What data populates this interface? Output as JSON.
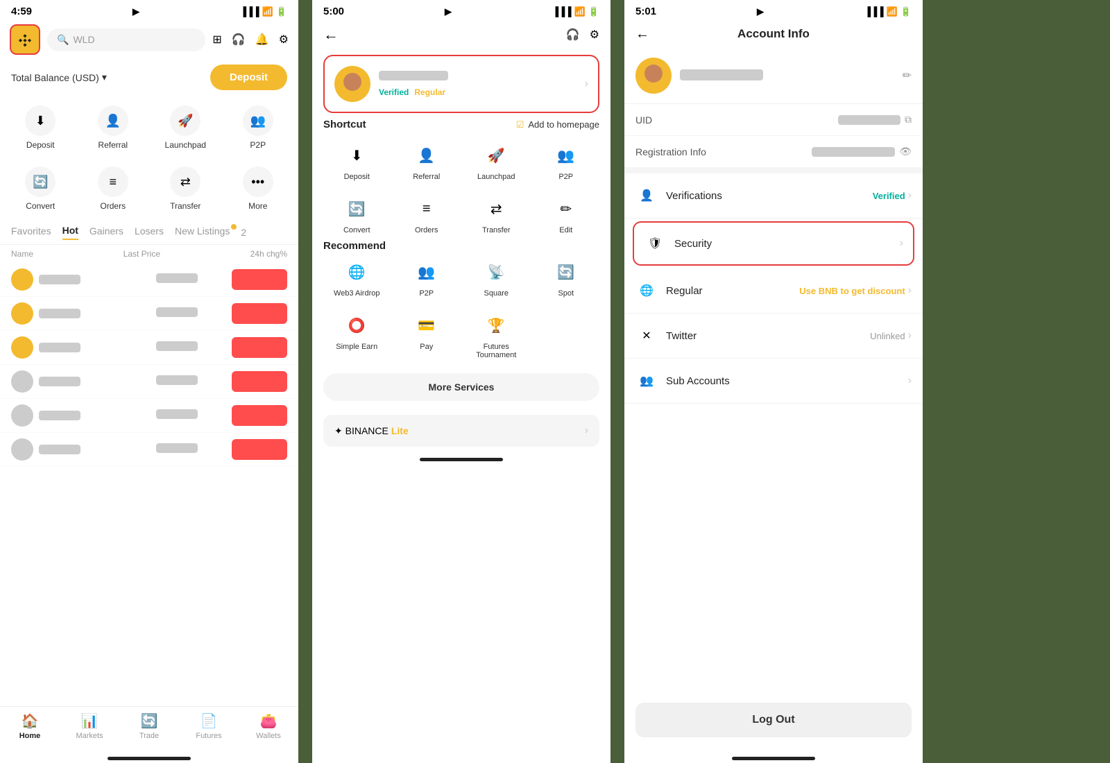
{
  "phone1": {
    "status": {
      "time": "4:59",
      "nav_icon": "▶"
    },
    "header": {
      "search_placeholder": "WLD"
    },
    "balance": {
      "label": "Total Balance (USD)",
      "deposit_btn": "Deposit"
    },
    "quick_actions": [
      {
        "icon": "⬇",
        "label": "Deposit"
      },
      {
        "icon": "👤",
        "label": "Referral"
      },
      {
        "icon": "🚀",
        "label": "Launchpad"
      },
      {
        "icon": "👥",
        "label": "P2P"
      },
      {
        "icon": "🔄",
        "label": "Convert"
      },
      {
        "icon": "≡",
        "label": "Orders"
      },
      {
        "icon": "⇄",
        "label": "Transfer"
      },
      {
        "icon": "•••",
        "label": "More"
      }
    ],
    "tabs": [
      {
        "label": "Favorites",
        "active": false
      },
      {
        "label": "Hot",
        "active": true
      },
      {
        "label": "Gainers",
        "active": false
      },
      {
        "label": "Losers",
        "active": false
      },
      {
        "label": "New Listings",
        "active": false,
        "badge": true
      }
    ],
    "market_headers": [
      "Name",
      "Last Price",
      "24h chg%"
    ],
    "market_rows": [
      {
        "coin_color": "yellow"
      },
      {
        "coin_color": "yellow"
      },
      {
        "coin_color": "yellow"
      },
      {
        "coin_color": "gray"
      },
      {
        "coin_color": "gray"
      },
      {
        "coin_color": "gray"
      }
    ],
    "bottom_nav": [
      {
        "icon": "🏠",
        "label": "Home",
        "active": true
      },
      {
        "icon": "📊",
        "label": "Markets",
        "active": false
      },
      {
        "icon": "🔄",
        "label": "Trade",
        "active": false
      },
      {
        "icon": "📄",
        "label": "Futures",
        "active": false
      },
      {
        "icon": "👛",
        "label": "Wallets",
        "active": false
      }
    ]
  },
  "phone2": {
    "status": {
      "time": "5:00",
      "nav_icon": "▶"
    },
    "profile": {
      "verified_badge": "Verified",
      "regular_badge": "Regular"
    },
    "shortcut": {
      "title": "Shortcut",
      "add_to_homepage": "Add to homepage"
    },
    "shortcut_items": [
      {
        "icon": "⬇",
        "label": "Deposit"
      },
      {
        "icon": "👤",
        "label": "Referral"
      },
      {
        "icon": "🚀",
        "label": "Launchpad"
      },
      {
        "icon": "👥",
        "label": "P2P"
      },
      {
        "icon": "🔄",
        "label": "Convert"
      },
      {
        "icon": "≡",
        "label": "Orders"
      },
      {
        "icon": "⇄",
        "label": "Transfer"
      },
      {
        "icon": "✏",
        "label": "Edit"
      }
    ],
    "recommend": {
      "title": "Recommend"
    },
    "recommend_items": [
      {
        "icon": "🌐",
        "label": "Web3 Airdrop"
      },
      {
        "icon": "👥",
        "label": "P2P"
      },
      {
        "icon": "📡",
        "label": "Square"
      },
      {
        "icon": "🔄",
        "label": "Spot"
      },
      {
        "icon": "⭕",
        "label": "Simple Earn"
      },
      {
        "icon": "💳",
        "label": "Pay"
      },
      {
        "icon": "🏆",
        "label": "Futures Tournament"
      }
    ],
    "more_services_btn": "More Services",
    "binance_lite": {
      "prefix": "✦ BINANCE",
      "suffix": "Lite"
    }
  },
  "phone3": {
    "status": {
      "time": "5:01",
      "nav_icon": "▶"
    },
    "page_title": "Account Info",
    "uid_label": "UID",
    "registration_label": "Registration Info",
    "menu_items": [
      {
        "icon": "👤",
        "label": "Verifications",
        "value": "Verified",
        "value_color": "green",
        "chevron": true,
        "highlighted": false
      },
      {
        "icon": "🛡",
        "label": "Security",
        "value": "",
        "chevron": true,
        "highlighted": true
      },
      {
        "icon": "🌐",
        "label": "Regular",
        "value": "Use BNB to get discount",
        "value_color": "yellow",
        "chevron": true,
        "highlighted": false
      },
      {
        "icon": "✕",
        "label": "Twitter",
        "value": "Unlinked",
        "value_color": "gray",
        "chevron": true,
        "highlighted": false
      },
      {
        "icon": "👥",
        "label": "Sub Accounts",
        "value": "",
        "chevron": true,
        "highlighted": false
      }
    ],
    "logout_btn": "Log Out"
  }
}
